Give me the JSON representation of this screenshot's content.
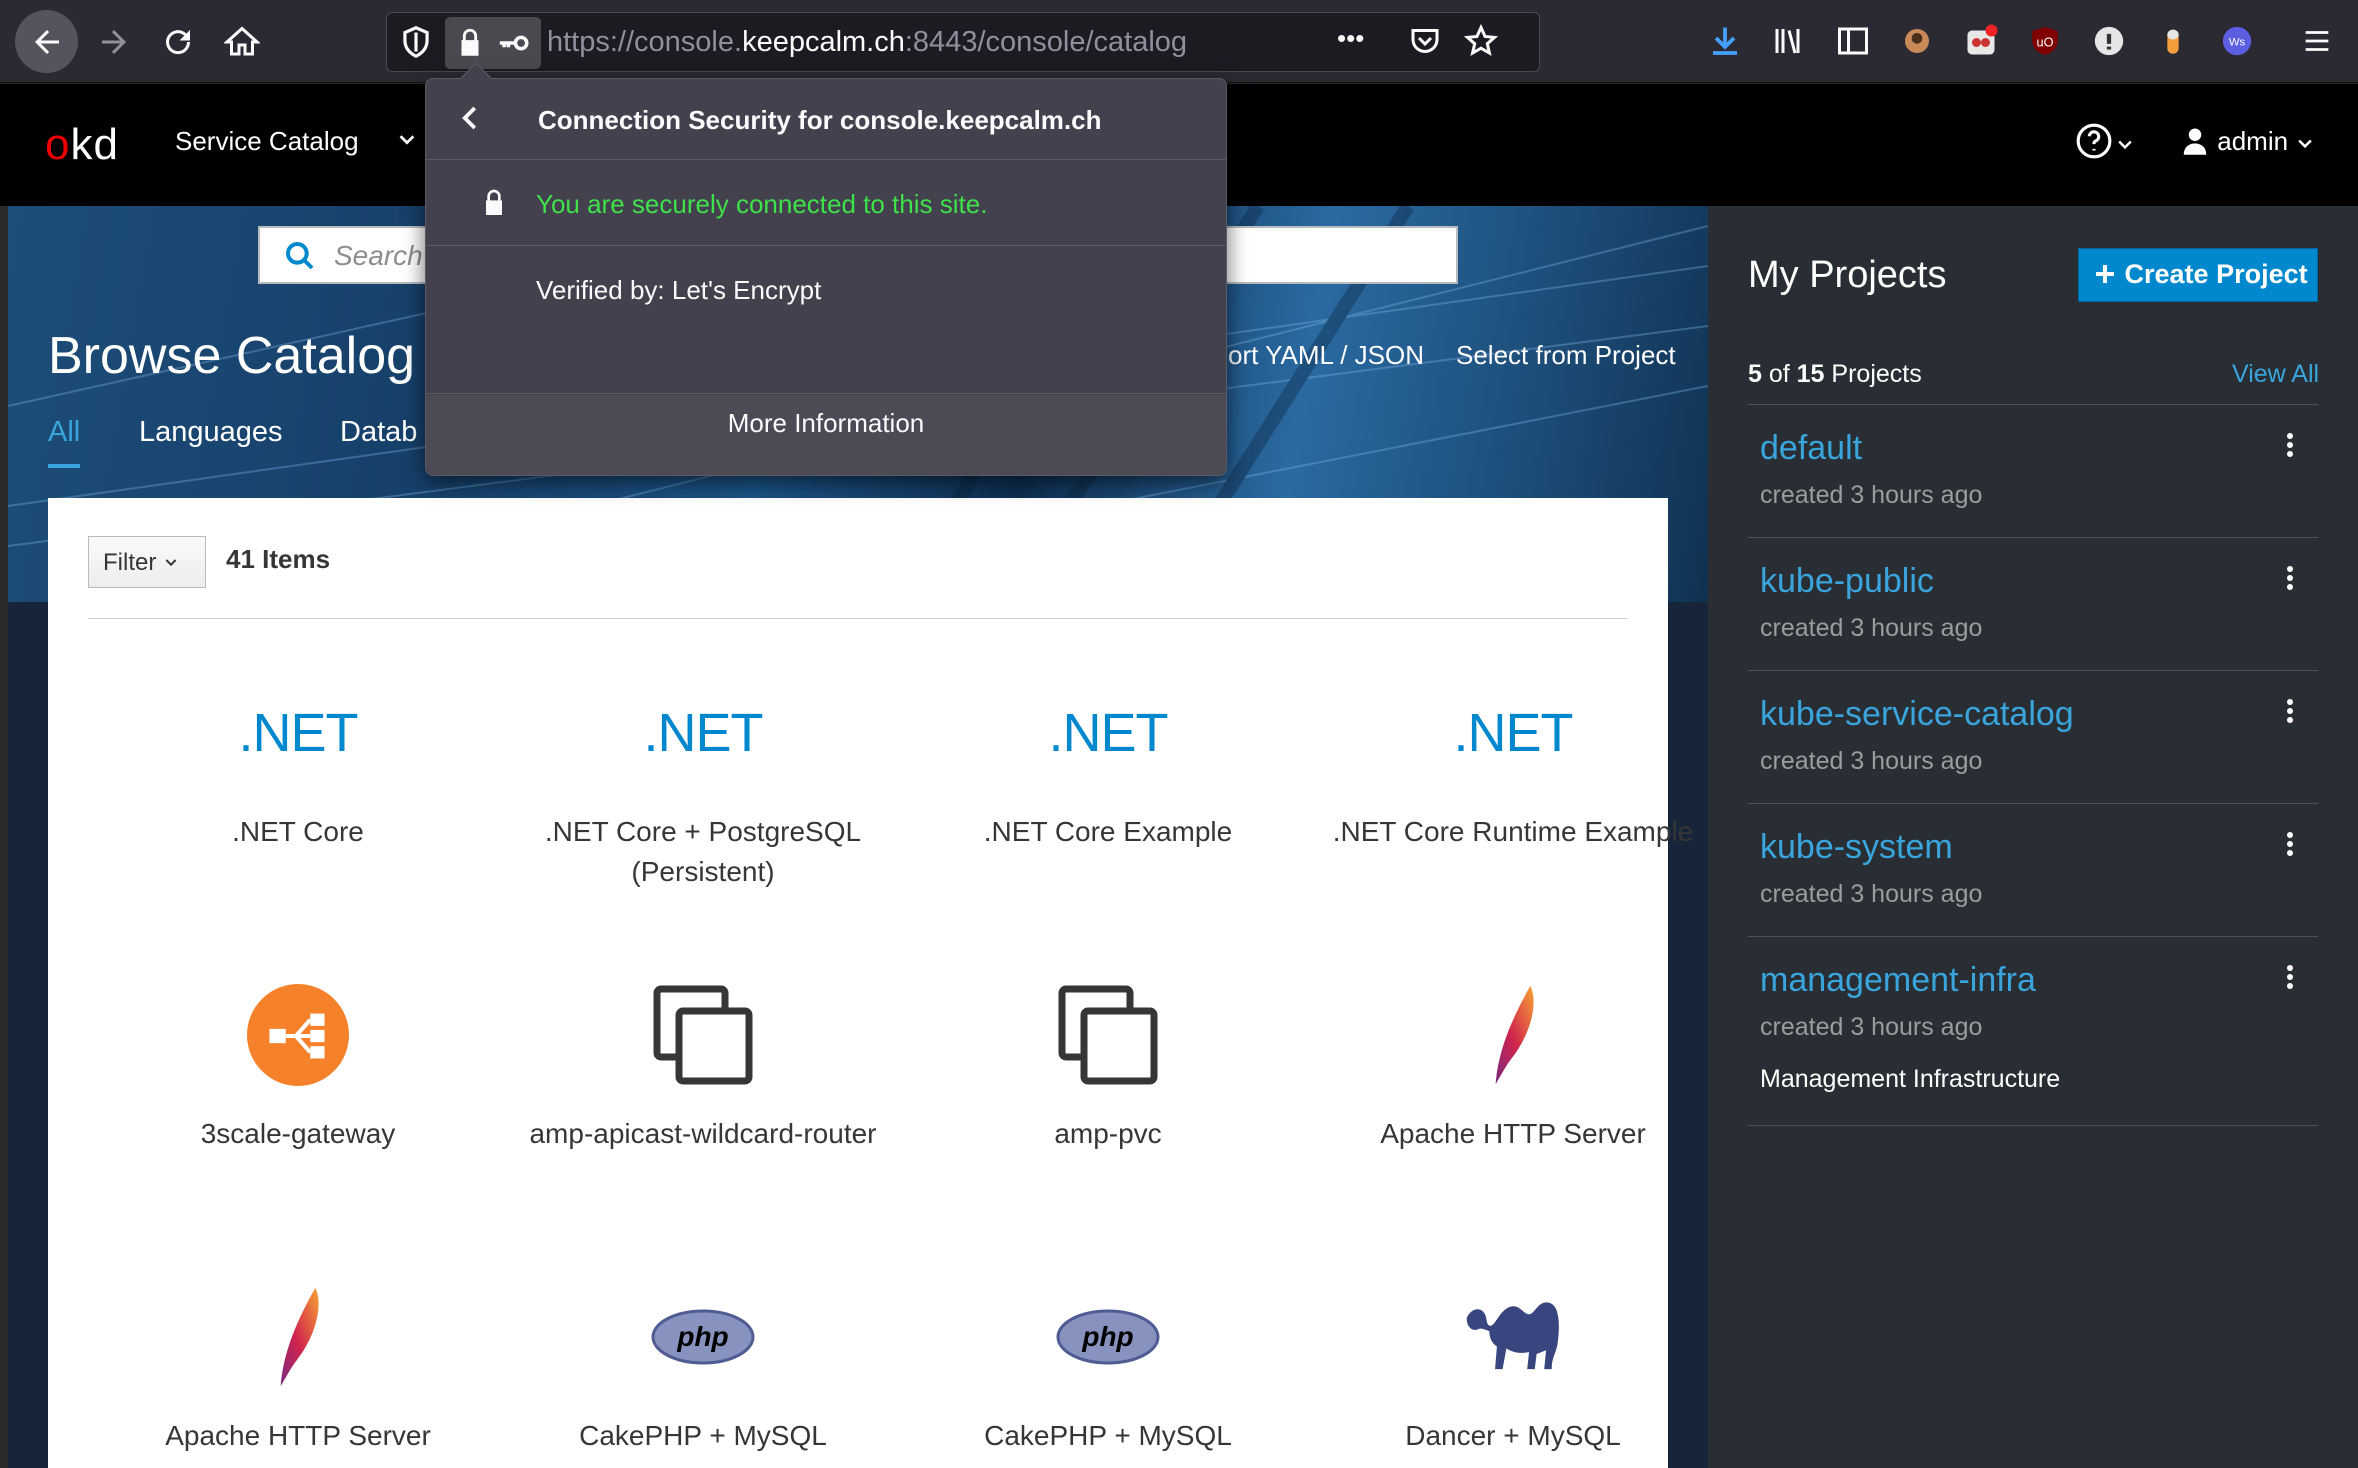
{
  "browser": {
    "url_prefix": "https://console.",
    "url_domain": "keepcalm.ch",
    "url_suffix": ":8443/console/catalog",
    "more_icon": "•••"
  },
  "header": {
    "logo": "kd",
    "logo_o": "o",
    "nav_label": "Service Catalog",
    "help_caret": "⌄",
    "user": "admin"
  },
  "hero": {
    "search_placeholder": "Search",
    "title": "Browse Catalog",
    "import_label": "ort YAML / JSON",
    "select_project_label": "Select from Project",
    "tabs": [
      "All",
      "Languages",
      "Datab"
    ]
  },
  "catalog": {
    "filter_label": "Filter",
    "items_count": "41 Items",
    "net_logo": ".NET",
    "items": [
      {
        "name": ".NET Core",
        "icon": "dotnet-icon"
      },
      {
        "name": ".NET Core + PostgreSQL (Persistent)",
        "icon": "dotnet-icon"
      },
      {
        "name": ".NET Core Example",
        "icon": "dotnet-icon"
      },
      {
        "name": ".NET Core Runtime Example",
        "icon": "dotnet-icon"
      },
      {
        "name": "3scale-gateway",
        "icon": "3scale-icon"
      },
      {
        "name": "amp-apicast-wildcard-router",
        "icon": "copy-icon"
      },
      {
        "name": "amp-pvc",
        "icon": "copy-icon"
      },
      {
        "name": "Apache HTTP Server",
        "icon": "apache-feather-icon"
      },
      {
        "name": "Apache HTTP Server",
        "icon": "apache-feather-icon"
      },
      {
        "name": "CakePHP + MySQL",
        "icon": "php-icon"
      },
      {
        "name": "CakePHP + MySQL",
        "icon": "php-icon"
      },
      {
        "name": "Dancer + MySQL",
        "icon": "perl-camel-icon"
      }
    ]
  },
  "sidebar": {
    "title": "My Projects",
    "create_label": "Create Project",
    "count_shown": "5",
    "count_of": " of ",
    "count_total": "15",
    "count_suffix": " Projects",
    "view_all": "View All",
    "projects": [
      {
        "name": "default",
        "created": "created 3 hours ago",
        "description": ""
      },
      {
        "name": "kube-public",
        "created": "created 3 hours ago",
        "description": ""
      },
      {
        "name": "kube-service-catalog",
        "created": "created 3 hours ago",
        "description": ""
      },
      {
        "name": "kube-system",
        "created": "created 3 hours ago",
        "description": ""
      },
      {
        "name": "management-infra",
        "created": "created 3 hours ago",
        "description": "Management Infrastructure"
      }
    ]
  },
  "security_popup": {
    "title": "Connection Security for console.keepcalm.ch",
    "secure_message": "You are securely connected to this site.",
    "verified_by": "Verified by: Let's Encrypt",
    "more_info": "More Information"
  },
  "colors": {
    "accent": "#39a5dc",
    "primary_button": "#0088ce",
    "secure_green": "#3fe14a",
    "okd_red": "#ee0000"
  }
}
